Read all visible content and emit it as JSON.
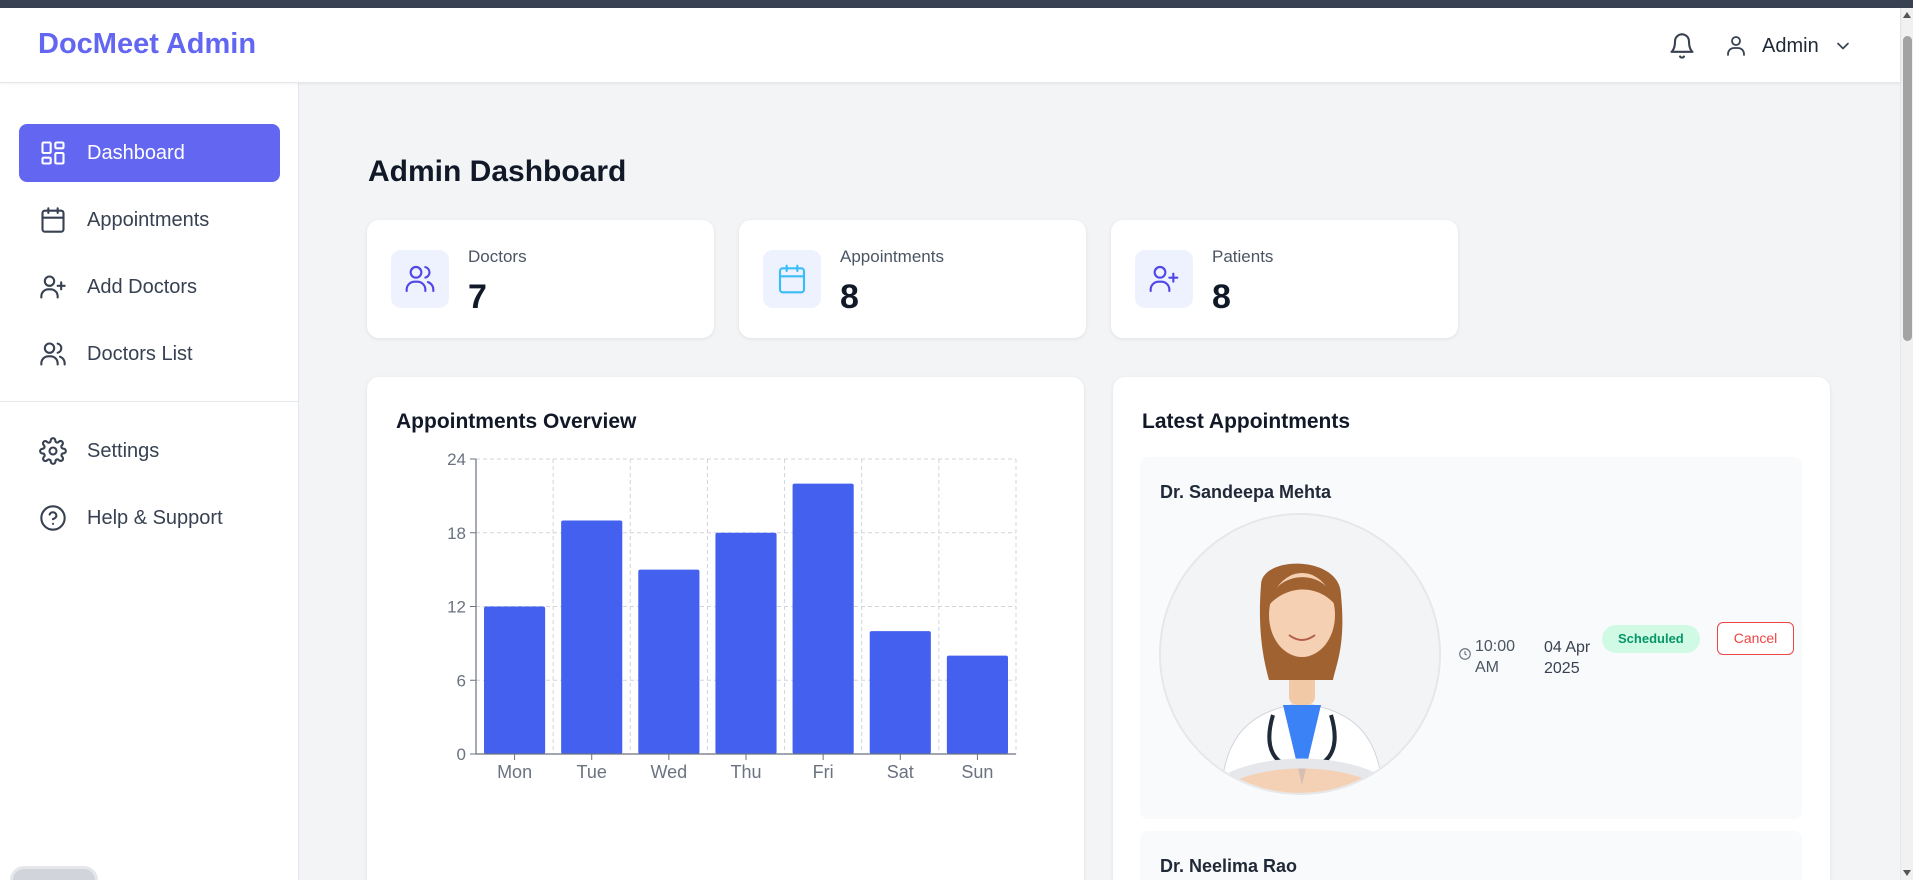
{
  "header": {
    "brand": "DocMeet Admin",
    "user_name": "Admin",
    "icons": {
      "notifications": "bell-icon",
      "user": "user-icon",
      "menu": "chevron-down-icon"
    }
  },
  "sidebar": {
    "items": [
      {
        "label": "Dashboard",
        "icon": "dashboard-icon",
        "active": true
      },
      {
        "label": "Appointments",
        "icon": "calendar-icon"
      },
      {
        "label": "Add Doctors",
        "icon": "user-plus-icon"
      },
      {
        "label": "Doctors List",
        "icon": "users-icon"
      },
      {
        "label": "Settings",
        "icon": "gear-icon"
      },
      {
        "label": "Help & Support",
        "icon": "help-circle-icon"
      }
    ]
  },
  "main": {
    "title": "Admin Dashboard",
    "stats": [
      {
        "label": "Doctors",
        "value": "7",
        "icon": "users-icon"
      },
      {
        "label": "Appointments",
        "value": "8",
        "icon": "calendar-icon"
      },
      {
        "label": "Patients",
        "value": "8",
        "icon": "user-plus-icon"
      }
    ],
    "overview": {
      "title": "Appointments Overview"
    },
    "latest": {
      "title": "Latest Appointments",
      "items": [
        {
          "doctor": "Dr. Sandeepa Mehta",
          "time": "10:00 AM",
          "date": "04 Apr 2025",
          "status": "Scheduled",
          "action": "Cancel"
        },
        {
          "doctor": "Dr. Neelima Rao"
        }
      ]
    }
  },
  "colors": {
    "accent": "#6366f1",
    "bar": "#4361ee",
    "status_scheduled": "#059669",
    "cancel": "#ef4444"
  },
  "chart_data": {
    "type": "bar",
    "categories": [
      "Mon",
      "Tue",
      "Wed",
      "Thu",
      "Fri",
      "Sat",
      "Sun"
    ],
    "values": [
      12,
      19,
      15,
      18,
      22,
      10,
      8
    ],
    "yticks": [
      "0",
      "6",
      "12",
      "18",
      "24"
    ],
    "ylim": [
      0,
      24
    ],
    "grid": true
  }
}
